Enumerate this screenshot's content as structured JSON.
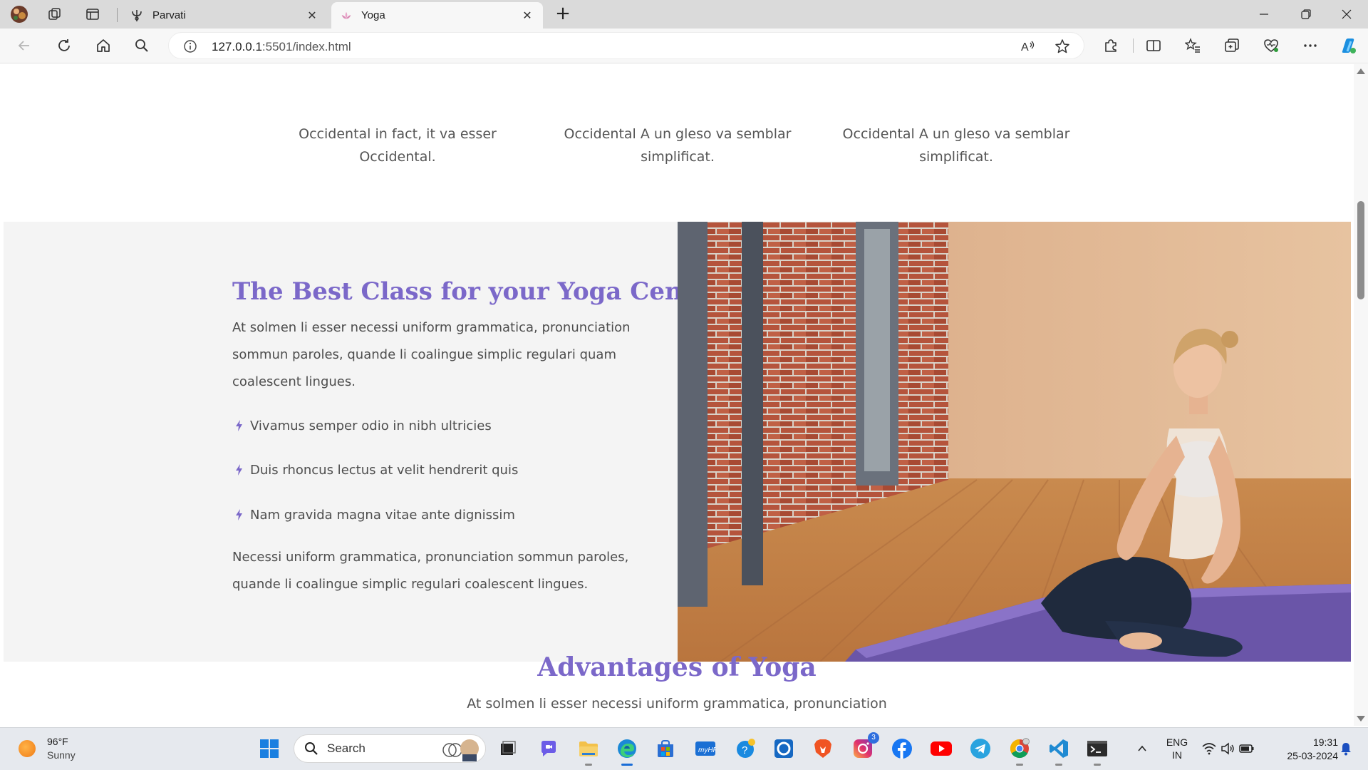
{
  "browser": {
    "tabs": [
      {
        "title": "Parvati",
        "active": false
      },
      {
        "title": "Yoga",
        "active": true
      }
    ],
    "url_host": "127.0.0.1",
    "url_path": ":5501/index.html"
  },
  "features": [
    {
      "text": "Occidental in fact, it va esser Occidental."
    },
    {
      "text": "Occidental A un gleso va semblar simplificat."
    },
    {
      "text": "Occidental A un gleso va semblar simplificat."
    }
  ],
  "class_section": {
    "title": "The Best Class for your Yoga Center",
    "intro": "At solmen li esser necessi uniform grammatica, pronunciation sommun paroles, quande li coalingue simplic regulari quam coalescent lingues.",
    "bullets": [
      "Vivamus semper odio in nibh ultricies",
      "Duis rhoncus lectus at velit hendrerit quis",
      "Nam gravida magna vitae ante dignissim"
    ],
    "outro": "Necessi uniform grammatica, pronunciation sommun paroles, quande li coalingue simplic regulari coalescent lingues."
  },
  "advantages": {
    "title": "Advantages of Yoga",
    "subtitle": "At solmen li esser necessi uniform grammatica, pronunciation"
  },
  "taskbar": {
    "weather_temp": "96°F",
    "weather_cond": "Sunny",
    "search_label": "Search",
    "instagram_badge": "3",
    "lang_top": "ENG",
    "lang_bottom": "IN",
    "time": "19:31",
    "date": "25-03-2024"
  },
  "colors": {
    "accent": "#7b68c9",
    "section_bg": "#f4f4f4",
    "body_text": "#4d4d4d"
  }
}
